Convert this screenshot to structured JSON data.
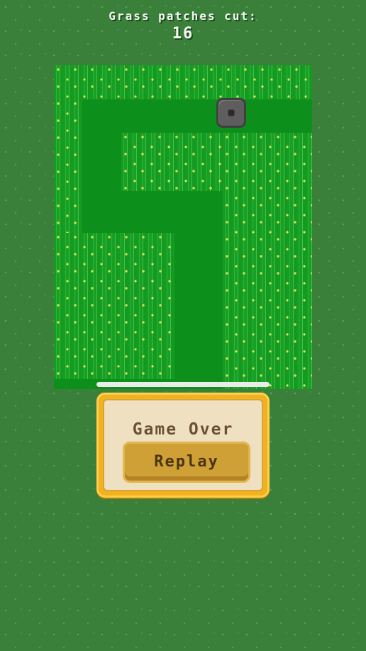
{
  "hud": {
    "label": "Grass patches cut:",
    "count": "16"
  },
  "progress": {
    "fraction": 1.0
  },
  "game_over": {
    "title": "Game Over",
    "replay_label": "Replay"
  },
  "colors": {
    "background": "#3a7f3a",
    "cut_grass": "#0d8f1c",
    "tall_grass": "#169c23",
    "flower": "#f0ef6a",
    "dialog_frame": "#f2b11e",
    "dialog_panel": "#efe0c2",
    "button": "#cfa035"
  },
  "icons": {
    "mower": "lawnmower-icon"
  }
}
